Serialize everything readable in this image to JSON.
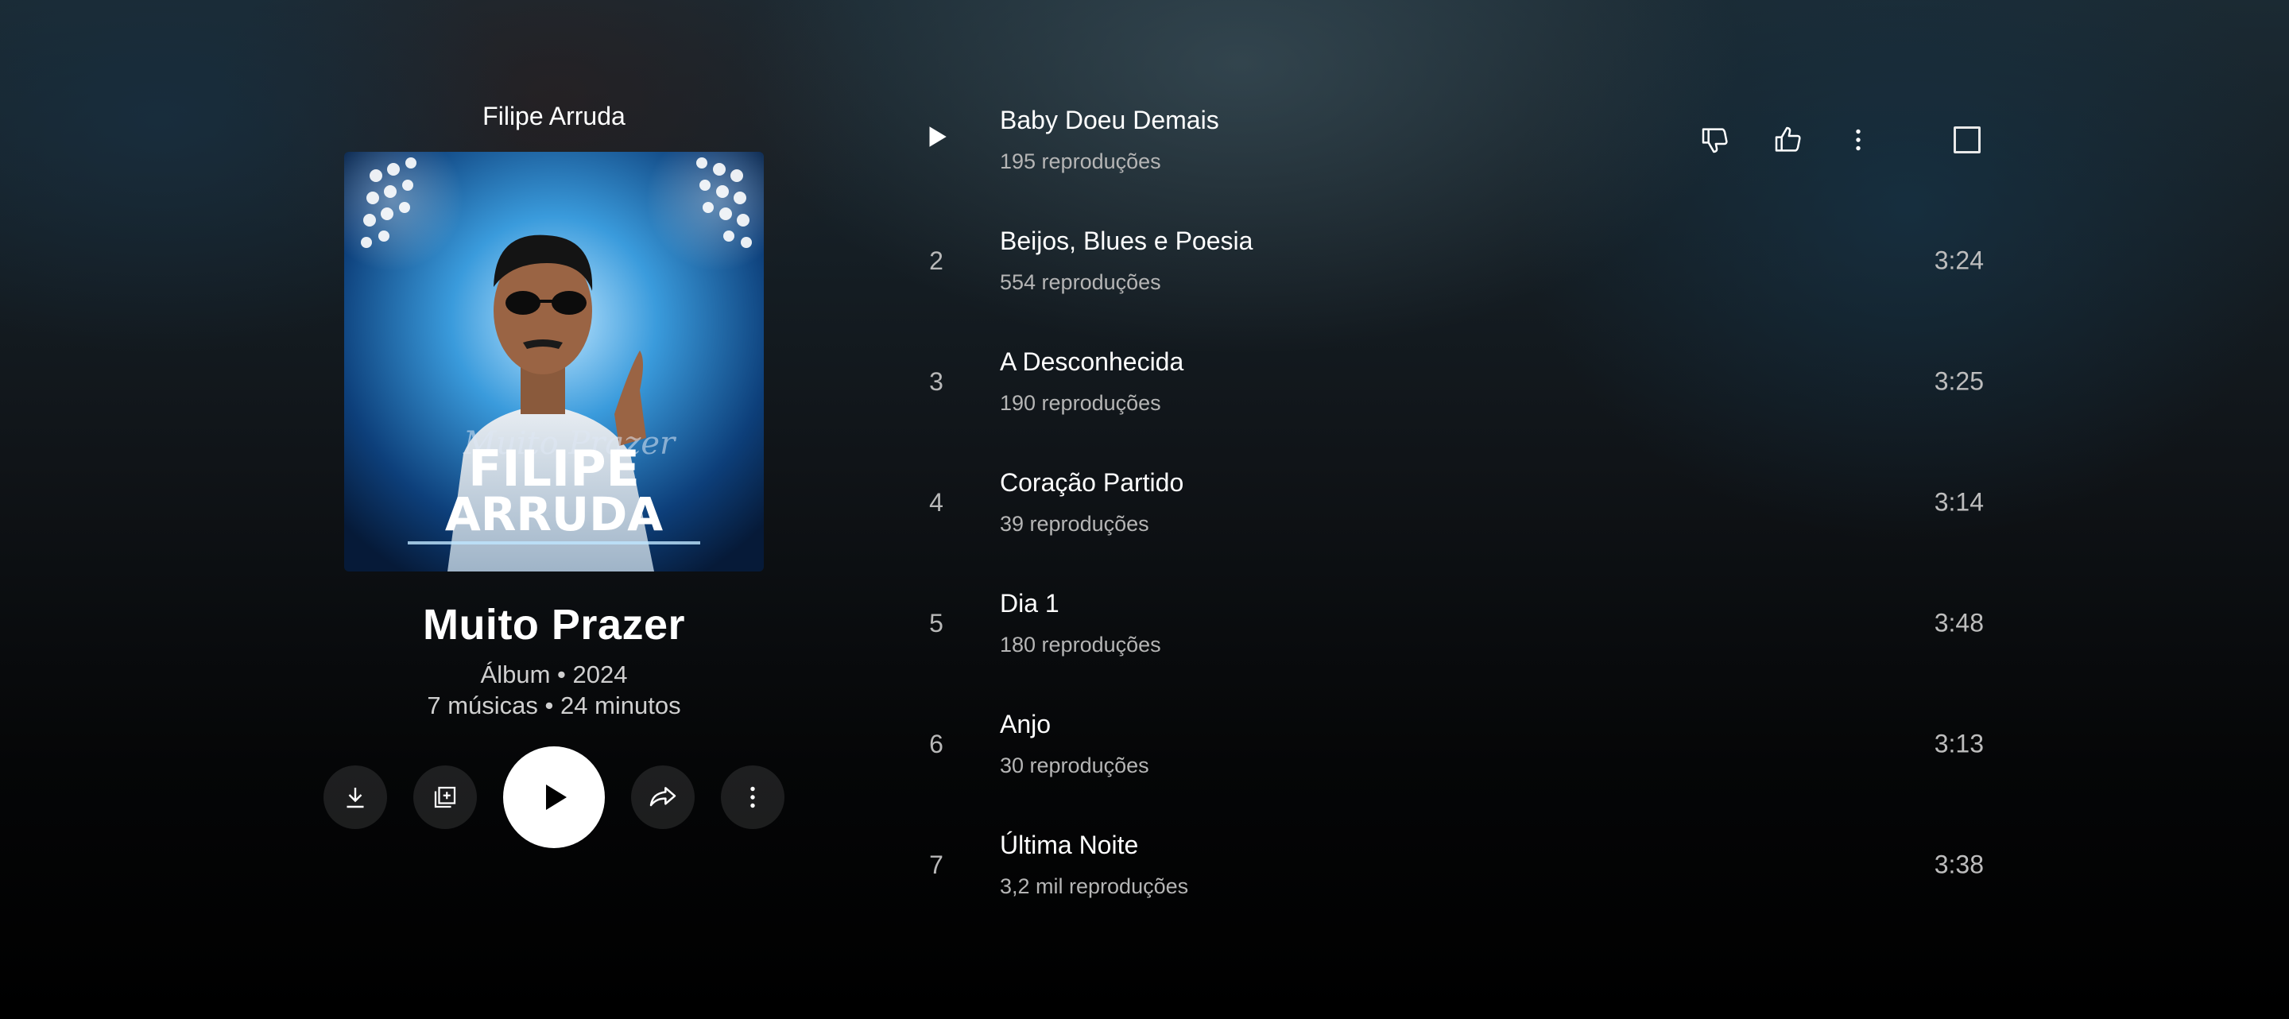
{
  "album": {
    "artist": "Filipe Arruda",
    "cover_text_line1": "FILIPE",
    "cover_text_line2": "ARRUDA",
    "cover_script": "Muito Prazer",
    "title": "Muito Prazer",
    "meta_line1": "Álbum • 2024",
    "meta_line2": "7 músicas • 24 minutos"
  },
  "actions": [
    {
      "name": "download-button",
      "icon": "download-icon"
    },
    {
      "name": "save-to-library-button",
      "icon": "library-add-icon"
    },
    {
      "name": "play-album-button",
      "icon": "play-icon"
    },
    {
      "name": "share-button",
      "icon": "share-icon"
    },
    {
      "name": "album-more-button",
      "icon": "more-vert-icon"
    }
  ],
  "tracks": [
    {
      "index": "1",
      "title": "Baby Doeu Demais",
      "plays": "195 reproduções",
      "duration": "",
      "hovered": true
    },
    {
      "index": "2",
      "title": "Beijos, Blues e Poesia",
      "plays": "554 reproduções",
      "duration": "3:24"
    },
    {
      "index": "3",
      "title": "A Desconhecida",
      "plays": "190 reproduções",
      "duration": "3:25"
    },
    {
      "index": "4",
      "title": "Coração Partido",
      "plays": "39 reproduções",
      "duration": "3:14"
    },
    {
      "index": "5",
      "title": "Dia 1",
      "plays": "180 reproduções",
      "duration": "3:48"
    },
    {
      "index": "6",
      "title": "Anjo",
      "plays": "30 reproduções",
      "duration": "3:13"
    },
    {
      "index": "7",
      "title": "Última Noite",
      "plays": "3,2 mil reproduções",
      "duration": "3:38"
    }
  ],
  "row_actions": [
    "thumbs-down-icon",
    "thumbs-up-icon",
    "more-vert-icon",
    "checkbox-icon"
  ],
  "colors": {
    "accent": "#ffffff",
    "secondary_text": "#b5b5b5"
  }
}
